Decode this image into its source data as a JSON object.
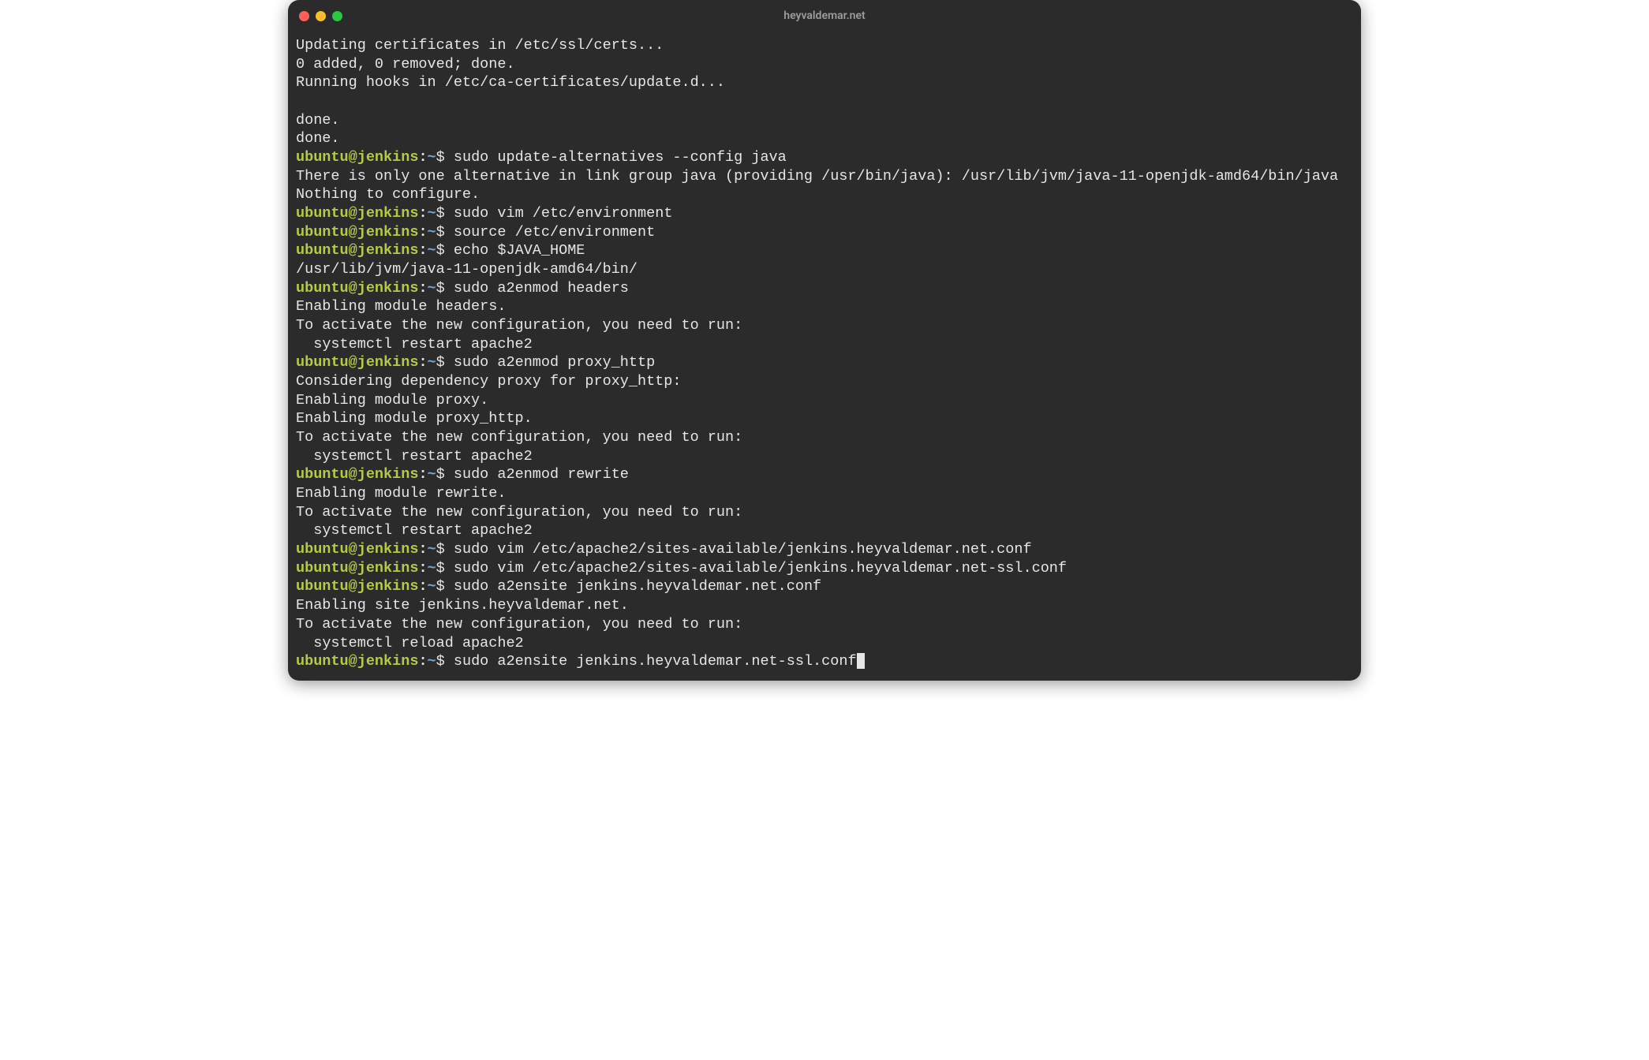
{
  "window": {
    "title": "heyvaldemar.net",
    "traffic_lights": {
      "red": "#ff5f57",
      "yellow": "#febc2e",
      "green": "#28c840"
    }
  },
  "prompt": {
    "user_host": "ubuntu@jenkins",
    "path": "~",
    "symbol": "$"
  },
  "lines": [
    {
      "type": "output",
      "text": "Updating certificates in /etc/ssl/certs..."
    },
    {
      "type": "output",
      "text": "0 added, 0 removed; done."
    },
    {
      "type": "output",
      "text": "Running hooks in /etc/ca-certificates/update.d..."
    },
    {
      "type": "output",
      "text": ""
    },
    {
      "type": "output",
      "text": "done."
    },
    {
      "type": "output",
      "text": "done."
    },
    {
      "type": "command",
      "text": "sudo update-alternatives --config java"
    },
    {
      "type": "output",
      "text": "There is only one alternative in link group java (providing /usr/bin/java): /usr/lib/jvm/java-11-openjdk-amd64/bin/java"
    },
    {
      "type": "output",
      "text": "Nothing to configure."
    },
    {
      "type": "command",
      "text": "sudo vim /etc/environment"
    },
    {
      "type": "command",
      "text": "source /etc/environment"
    },
    {
      "type": "command",
      "text": "echo $JAVA_HOME"
    },
    {
      "type": "output",
      "text": "/usr/lib/jvm/java-11-openjdk-amd64/bin/"
    },
    {
      "type": "command",
      "text": "sudo a2enmod headers"
    },
    {
      "type": "output",
      "text": "Enabling module headers."
    },
    {
      "type": "output",
      "text": "To activate the new configuration, you need to run:"
    },
    {
      "type": "output",
      "text": "  systemctl restart apache2"
    },
    {
      "type": "command",
      "text": "sudo a2enmod proxy_http"
    },
    {
      "type": "output",
      "text": "Considering dependency proxy for proxy_http:"
    },
    {
      "type": "output",
      "text": "Enabling module proxy."
    },
    {
      "type": "output",
      "text": "Enabling module proxy_http."
    },
    {
      "type": "output",
      "text": "To activate the new configuration, you need to run:"
    },
    {
      "type": "output",
      "text": "  systemctl restart apache2"
    },
    {
      "type": "command",
      "text": "sudo a2enmod rewrite"
    },
    {
      "type": "output",
      "text": "Enabling module rewrite."
    },
    {
      "type": "output",
      "text": "To activate the new configuration, you need to run:"
    },
    {
      "type": "output",
      "text": "  systemctl restart apache2"
    },
    {
      "type": "command",
      "text": "sudo vim /etc/apache2/sites-available/jenkins.heyvaldemar.net.conf"
    },
    {
      "type": "command",
      "text": "sudo vim /etc/apache2/sites-available/jenkins.heyvaldemar.net-ssl.conf"
    },
    {
      "type": "command",
      "text": "sudo a2ensite jenkins.heyvaldemar.net.conf"
    },
    {
      "type": "output",
      "text": "Enabling site jenkins.heyvaldemar.net."
    },
    {
      "type": "output",
      "text": "To activate the new configuration, you need to run:"
    },
    {
      "type": "output",
      "text": "  systemctl reload apache2"
    },
    {
      "type": "command",
      "text": "sudo a2ensite jenkins.heyvaldemar.net-ssl.conf",
      "cursor": true
    }
  ]
}
